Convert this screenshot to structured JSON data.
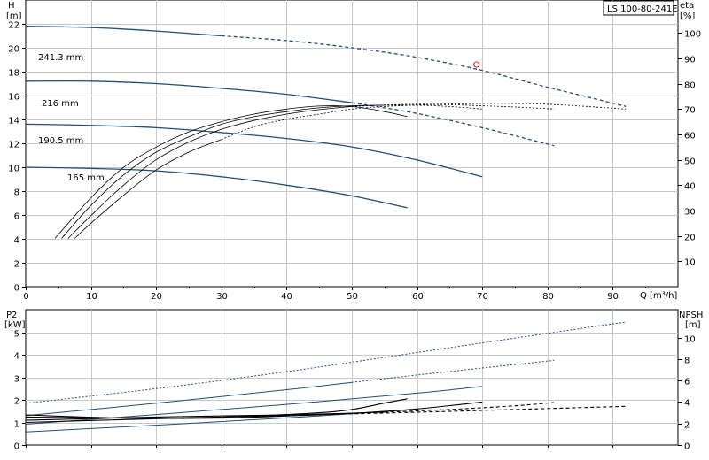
{
  "top_chart": {
    "title_box": "LS 100-80-241E",
    "left_axis_label": "H",
    "left_axis_unit": "[m]",
    "right_axis_label": "eta",
    "right_axis_unit": "[%]",
    "x_axis_label": "Q [m³/h]",
    "marker_label": "O",
    "x_ticks": [
      "0",
      "10",
      "20",
      "30",
      "40",
      "50",
      "60",
      "70",
      "80",
      "90"
    ],
    "h_ticks": [
      "0",
      "2",
      "4",
      "6",
      "8",
      "10",
      "12",
      "14",
      "16",
      "18",
      "20",
      "22"
    ],
    "eta_ticks": [
      "10",
      "20",
      "30",
      "40",
      "50",
      "60",
      "70",
      "80",
      "90",
      "100"
    ],
    "curve_labels": [
      "241.3 mm",
      "216 mm",
      "190.5 mm",
      "165 mm"
    ]
  },
  "bottom_chart": {
    "left_axis_label": "P2",
    "left_axis_unit": "[kW]",
    "right_axis_label": "NPSH",
    "right_axis_unit": "[m]",
    "p2_ticks": [
      "0",
      "1",
      "2",
      "3",
      "4",
      "5"
    ],
    "npsh_ticks": [
      "0",
      "2",
      "4",
      "6",
      "8",
      "10"
    ]
  },
  "colors": {
    "head_curve": "#1f4e79",
    "eff_curve": "#000000",
    "power_curve": "#1f4e79",
    "npsh_curve": "#000000",
    "marker": "#cc0000",
    "grid": "#c8c8c8"
  },
  "chart_data": [
    {
      "type": "line",
      "title": "LS 100-80-241E",
      "xlabel": "Q [m³/h]",
      "ylabel": "H [m]",
      "y2label": "eta [%]",
      "xlim": [
        0,
        100
      ],
      "ylim": [
        0,
        24
      ],
      "y2lim": [
        0,
        113
      ],
      "grid": true,
      "series": [
        {
          "name": "241.3 mm",
          "axis": "H",
          "x": [
            0,
            10,
            20,
            30,
            40,
            50,
            60,
            70,
            80,
            92
          ],
          "y": [
            21.8,
            21.7,
            21.4,
            21.0,
            20.6,
            20.0,
            19.2,
            18.1,
            16.7,
            15.1
          ],
          "solid_until": 30
        },
        {
          "name": "216 mm",
          "axis": "H",
          "x": [
            0,
            10,
            20,
            30,
            40,
            50,
            60,
            70,
            81
          ],
          "y": [
            17.2,
            17.2,
            17.0,
            16.6,
            16.1,
            15.4,
            14.5,
            13.3,
            11.8
          ],
          "solid_until": 50
        },
        {
          "name": "190.5 mm",
          "axis": "H",
          "x": [
            0,
            10,
            20,
            30,
            40,
            50,
            60,
            70
          ],
          "y": [
            13.6,
            13.5,
            13.3,
            12.9,
            12.4,
            11.7,
            10.6,
            9.2
          ],
          "solid_until": 70
        },
        {
          "name": "165 mm",
          "axis": "H",
          "x": [
            0,
            10,
            20,
            30,
            40,
            50,
            58.5
          ],
          "y": [
            10.0,
            9.9,
            9.7,
            9.2,
            8.5,
            7.6,
            6.6
          ],
          "solid_until": 58.5
        },
        {
          "axis": "eta",
          "x": [
            4.5,
            10,
            15,
            20,
            25,
            30,
            35,
            40,
            45,
            50,
            55,
            58.5
          ],
          "y": [
            19,
            35,
            47,
            55,
            61,
            65,
            68,
            70,
            71.2,
            71,
            69,
            67
          ],
          "solid_until": 58.5
        },
        {
          "axis": "eta",
          "x": [
            5.5,
            10,
            15,
            20,
            25,
            30,
            35,
            40,
            45,
            50,
            55,
            60,
            65,
            70
          ],
          "y": [
            19,
            32,
            44,
            53,
            59,
            64,
            67,
            69,
            70.5,
            71.3,
            71.5,
            71.5,
            71,
            70
          ],
          "solid_until": 55
        },
        {
          "axis": "eta",
          "x": [
            6.5,
            10,
            15,
            20,
            25,
            30,
            35,
            40,
            45,
            50,
            55,
            60,
            65,
            70,
            75,
            81
          ],
          "y": [
            19,
            28,
            40,
            50,
            57,
            62,
            65.5,
            68,
            69.8,
            71,
            71.6,
            71.9,
            71.7,
            71.3,
            70.8,
            70
          ],
          "solid_until": 50
        },
        {
          "axis": "eta",
          "x": [
            7.5,
            10,
            15,
            20,
            25,
            30,
            35,
            40,
            45,
            50,
            55,
            60,
            70,
            80,
            92
          ],
          "y": [
            19,
            25,
            36,
            46,
            53,
            58,
            63,
            66,
            68,
            70,
            71,
            71.6,
            72.2,
            71.9,
            70
          ],
          "solid_until": 30
        }
      ],
      "operating_point": {
        "x": 69,
        "y": 18.2
      }
    },
    {
      "type": "line",
      "xlabel": "Q [m³/h]",
      "ylabel": "P2 [kW]",
      "y2label": "NPSH [m]",
      "xlim": [
        0,
        100
      ],
      "ylim": [
        0,
        6
      ],
      "y2lim": [
        0,
        12.6
      ],
      "grid": true,
      "series": [
        {
          "axis": "P2",
          "x": [
            0,
            20,
            40,
            60,
            80,
            92
          ],
          "y": [
            1.85,
            2.5,
            3.25,
            4.1,
            4.95,
            5.45
          ],
          "solid_until": 0
        },
        {
          "axis": "P2",
          "x": [
            0,
            20,
            40,
            60,
            81
          ],
          "y": [
            1.3,
            1.85,
            2.45,
            3.1,
            3.75
          ],
          "solid_until": 50
        },
        {
          "axis": "P2",
          "x": [
            0,
            20,
            40,
            60,
            70
          ],
          "y": [
            0.92,
            1.35,
            1.8,
            2.3,
            2.6
          ],
          "solid_until": 70
        },
        {
          "axis": "P2",
          "x": [
            0,
            20,
            40,
            58.5
          ],
          "y": [
            0.58,
            0.88,
            1.2,
            1.55
          ],
          "solid_until": 58.5
        },
        {
          "axis": "NPSH",
          "x": [
            0,
            15,
            25,
            35,
            45,
            50,
            55,
            58.5
          ],
          "y": [
            2.6,
            2.5,
            2.5,
            2.7,
            3.0,
            3.3,
            3.9,
            4.3
          ],
          "solid_until": 58.5
        },
        {
          "axis": "NPSH",
          "x": [
            0,
            15,
            30,
            40,
            50,
            60,
            70
          ],
          "y": [
            2.8,
            2.5,
            2.5,
            2.7,
            2.95,
            3.35,
            4.0
          ],
          "solid_until": 70
        },
        {
          "axis": "NPSH",
          "x": [
            0,
            20,
            40,
            55,
            65,
            75,
            81
          ],
          "y": [
            2.3,
            2.6,
            2.8,
            3.05,
            3.3,
            3.65,
            3.95
          ],
          "solid_until": 55
        },
        {
          "axis": "NPSH",
          "x": [
            0,
            20,
            40,
            60,
            75,
            92
          ],
          "y": [
            2.1,
            2.45,
            2.75,
            3.05,
            3.3,
            3.6
          ],
          "solid_until": 40
        }
      ]
    }
  ]
}
